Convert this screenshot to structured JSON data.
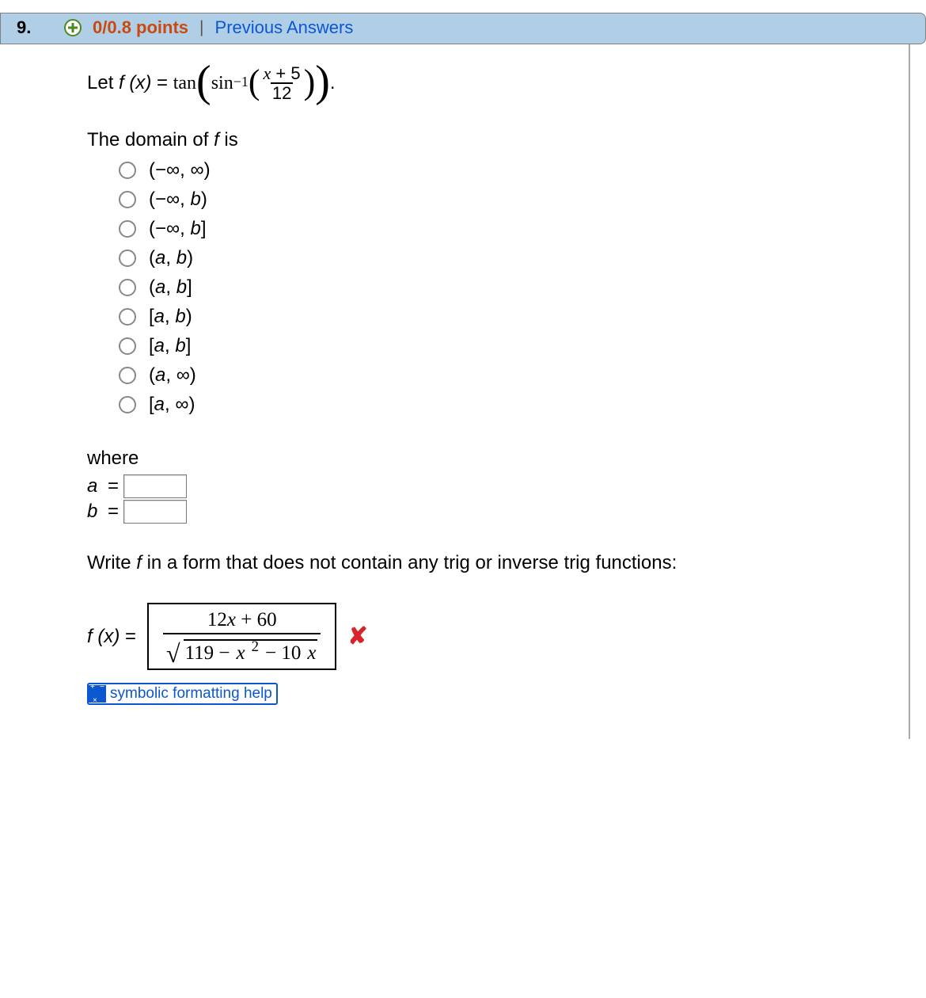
{
  "header": {
    "number": "9.",
    "points": "0/0.8 points",
    "divider": "|",
    "prev_link": "Previous Answers"
  },
  "problem": {
    "let_prefix": "Let ",
    "fx": "f (x)",
    "eq": " = ",
    "tan": "tan",
    "sin": "sin",
    "inv": "−1",
    "frac_num": "x + 5",
    "frac_den": "12",
    "period": "."
  },
  "domain_prompt_plain": "The domain of ",
  "domain_prompt_var": "f",
  "domain_prompt_tail": " is",
  "options": [
    {
      "text": "(−∞, ∞)"
    },
    {
      "text": "(−∞, b)",
      "b_ital": true
    },
    {
      "text": "(−∞, b]",
      "b_ital": true
    },
    {
      "text": "(a, b)",
      "ab_ital": true
    },
    {
      "text": "(a, b]",
      "ab_ital": true
    },
    {
      "text": "[a, b)",
      "ab_ital": true
    },
    {
      "text": "[a, b]",
      "ab_ital": true
    },
    {
      "text": "(a, ∞)",
      "a_ital": true
    },
    {
      "text": "[a, ∞)",
      "a_ital": true
    }
  ],
  "where": {
    "label": "where",
    "a": "a",
    "b": "b",
    "eq": " = "
  },
  "rewrite_prompt_1": "Write ",
  "rewrite_prompt_var": "f",
  "rewrite_prompt_2": " in a form that does not contain any trig or inverse trig functions:",
  "answer": {
    "fx": "f (x)",
    "eq": " = ",
    "top_a": "12",
    "top_var": "x",
    "top_b": " + 60",
    "bot_a": "119 − ",
    "bot_varsq_x": "x",
    "bot_b": " − 10",
    "bot_var2": "x"
  },
  "help_label": "symbolic formatting help"
}
